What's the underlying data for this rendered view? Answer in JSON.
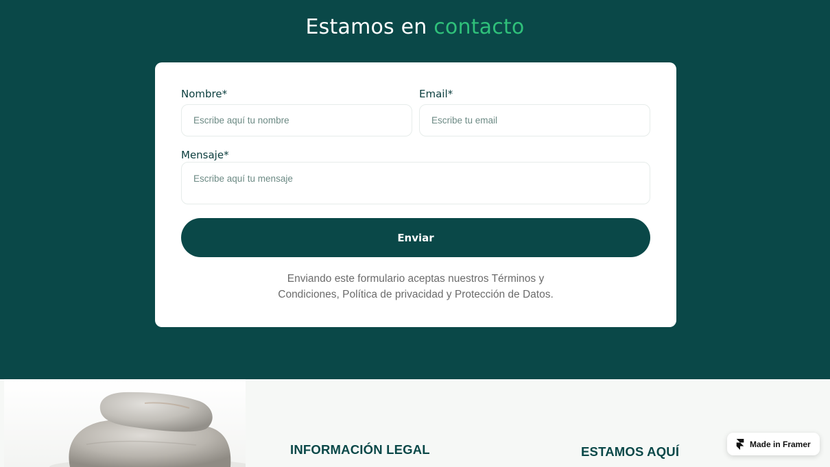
{
  "contact": {
    "title_prefix": "Estamos en",
    "title_accent": "contacto",
    "form": {
      "name_label": "Nombre*",
      "name_placeholder": "Escribe aquí tu nombre",
      "email_label": "Email*",
      "email_placeholder": "Escribe tu email",
      "message_label": "Mensaje*",
      "message_placeholder": "Escribe aquí tu mensaje",
      "submit_label": "Enviar",
      "disclaimer": "Enviando este formulario aceptas nuestros Términos y Condiciones, Política de privacidad y Protección de Datos."
    }
  },
  "footer": {
    "legal_heading": "INFORMACIÓN LEGAL",
    "location_heading": "ESTAMOS AQUÍ"
  },
  "badge": {
    "label": "Made in Framer"
  },
  "colors": {
    "primary": "#0a4848",
    "accent": "#2fc07a",
    "background": "#f6f8f6"
  }
}
